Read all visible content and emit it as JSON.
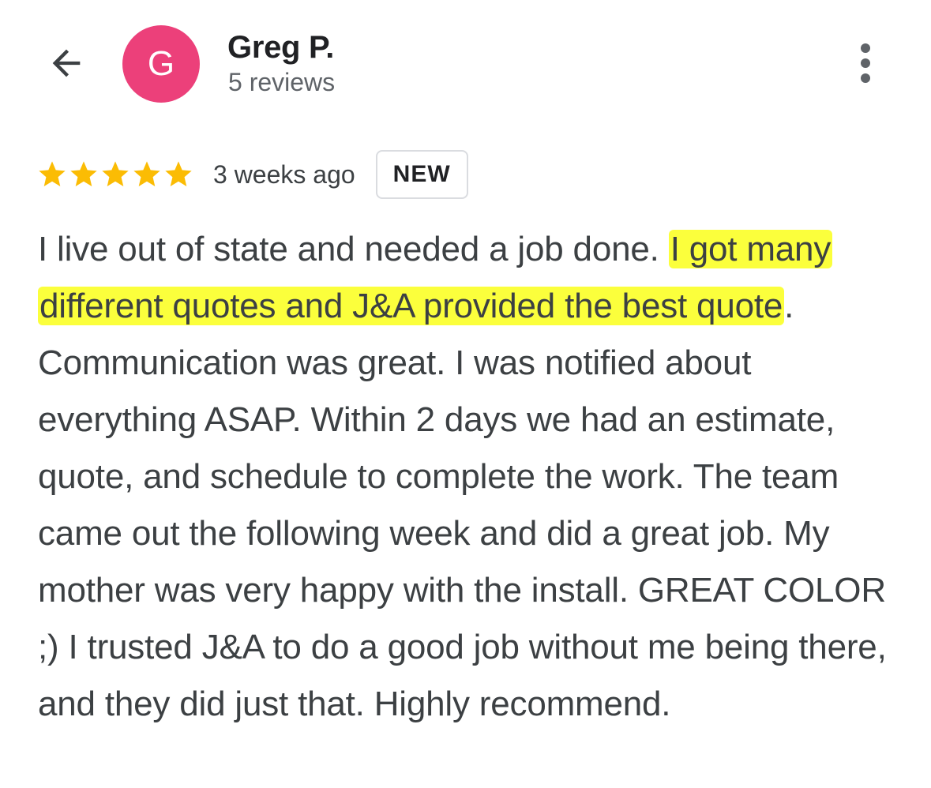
{
  "header": {
    "avatar_letter": "G",
    "avatar_color": "#ec407a",
    "user_name": "Greg P.",
    "review_count": "5 reviews",
    "back_icon": "arrow-left-icon",
    "more_icon": "more-vert-icon"
  },
  "review": {
    "rating": 5,
    "max_rating": 5,
    "star_color": "#fbbc04",
    "time_ago": "3 weeks ago",
    "badge": "NEW",
    "highlight_color": "#fbff3c",
    "text_before": "I live out of state and needed a job done. ",
    "text_highlighted": "I got many different quotes and J&A provided the best quote",
    "text_after": ". Communication was great. I was notified about everything ASAP. Within 2 days we had an estimate, quote, and schedule to complete the work. The team came out the following week and did a great job. My mother was very happy with the install. GREAT COLOR ;) I trusted J&A to do a good job without me being there, and they did just that. Highly recommend."
  }
}
